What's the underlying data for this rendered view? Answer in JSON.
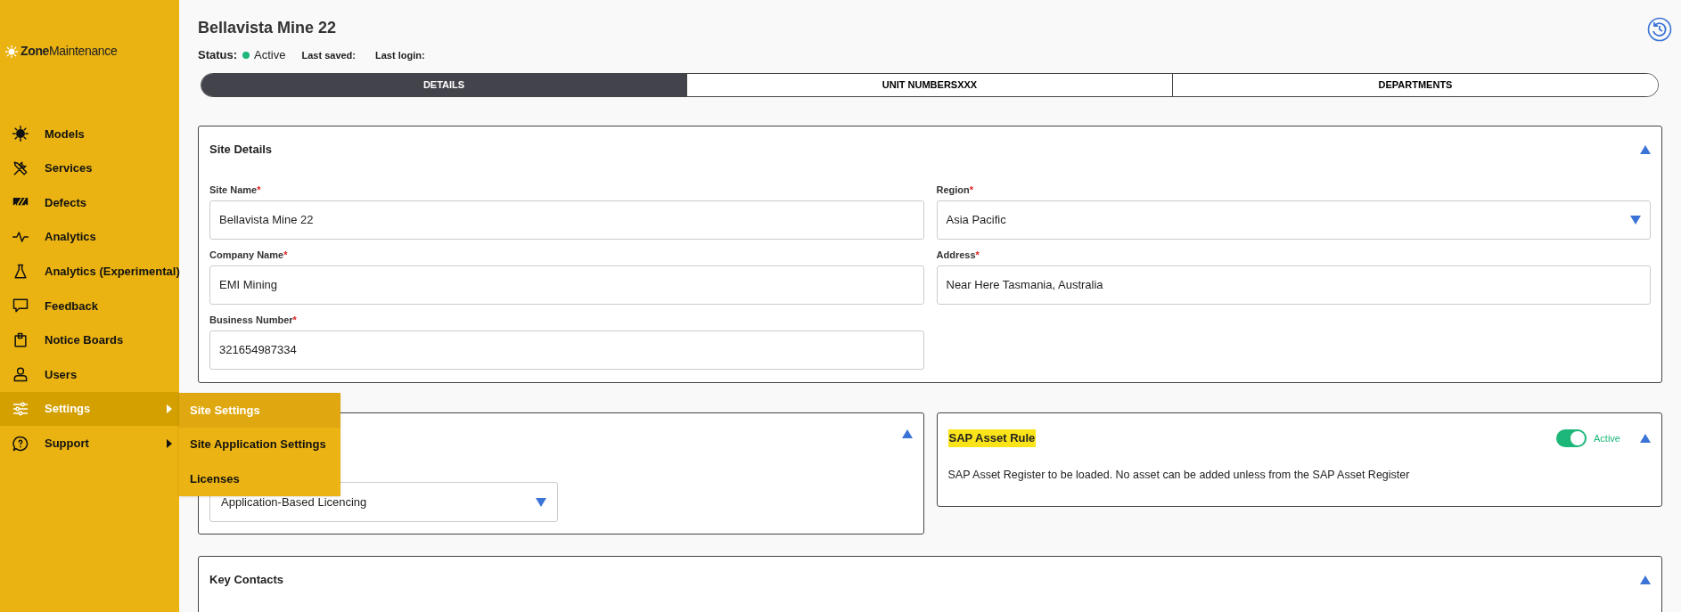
{
  "sidebar": {
    "logo": {
      "strong": "Zone",
      "light": "Maintenance"
    },
    "items": [
      {
        "label": "Models",
        "selected": false,
        "has_submenu": false
      },
      {
        "label": "Services",
        "selected": false,
        "has_submenu": false
      },
      {
        "label": "Defects",
        "selected": false,
        "has_submenu": false
      },
      {
        "label": "Analytics",
        "selected": false,
        "has_submenu": false
      },
      {
        "label": "Analytics (Experimental)",
        "selected": false,
        "has_submenu": false
      },
      {
        "label": "Feedback",
        "selected": false,
        "has_submenu": false
      },
      {
        "label": "Notice Boards",
        "selected": false,
        "has_submenu": false
      },
      {
        "label": "Users",
        "selected": false,
        "has_submenu": false
      },
      {
        "label": "Settings",
        "selected": true,
        "has_submenu": true
      },
      {
        "label": "Support",
        "selected": false,
        "has_submenu": true
      }
    ],
    "submenu": [
      {
        "label": "Site Settings",
        "selected": true
      },
      {
        "label": "Site Application Settings",
        "selected": false
      },
      {
        "label": "Licenses",
        "selected": false
      }
    ]
  },
  "header": {
    "title": "Bellavista Mine 22",
    "status_label": "Status:",
    "status": "Active",
    "last_saved": "Last saved:",
    "last_login": "Last login:"
  },
  "tabs": [
    {
      "label": "DETAILS",
      "selected": true
    },
    {
      "label": "UNIT NUMBERSXXX",
      "selected": false
    },
    {
      "label": "DEPARTMENTS",
      "selected": false
    }
  ],
  "site_details": {
    "title": "Site Details",
    "expanded": true,
    "fields": [
      {
        "label": "Site Name",
        "required_mark": "*",
        "value": "Bellavista Mine 22",
        "kind": "text"
      },
      {
        "label": "Region",
        "required_mark": "*",
        "value": "Asia Pacific",
        "kind": "select"
      },
      {
        "label": "Company Name",
        "required_mark": "*",
        "value": "EMI Mining",
        "kind": "text"
      },
      {
        "label": "Address",
        "required_mark": "*",
        "value": "Near Here Tasmania, Australia",
        "kind": "text"
      },
      {
        "label": "Business Number",
        "required_mark": "*",
        "value": "321654987334",
        "kind": "text"
      }
    ]
  },
  "licencing_card": {
    "expanded": true,
    "value": "Application-Based Licencing"
  },
  "sap_card": {
    "title": "SAP Asset Rule",
    "expanded": true,
    "toggle": {
      "on": true,
      "label": "Active"
    },
    "description": "SAP Asset Register to be loaded. No asset can be added unless from the SAP Asset Register"
  },
  "key_contacts": {
    "title": "Key Contacts",
    "expanded": true
  }
}
